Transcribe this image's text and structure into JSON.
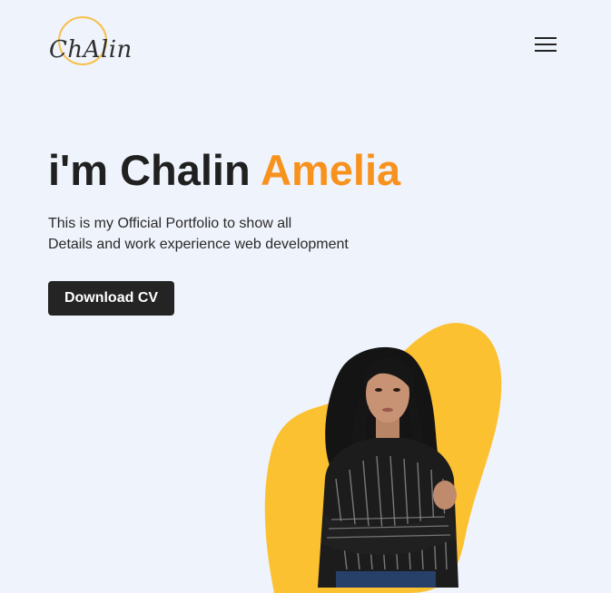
{
  "header": {
    "logo_text": "ChAlin",
    "menu_icon": "hamburger-menu-icon"
  },
  "hero": {
    "title_prefix": "i'm Chalin ",
    "title_accent": "Amelia",
    "description_line1": "This is my Official Portfolio to show all",
    "description_line2": "Details and work experience web development",
    "download_label": "Download CV"
  },
  "colors": {
    "background": "#eff3fb",
    "accent_orange": "#f7921d",
    "blob_yellow": "#fcc131",
    "logo_ring": "#f7c04a",
    "button_dark": "#242424"
  }
}
